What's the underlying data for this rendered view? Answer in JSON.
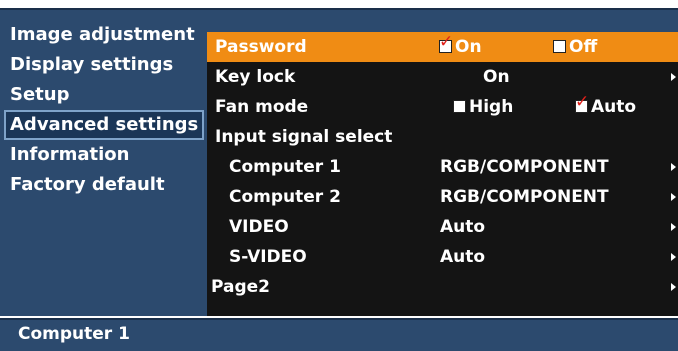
{
  "sidebar": {
    "items": [
      {
        "label": "Image adjustment"
      },
      {
        "label": "Display settings"
      },
      {
        "label": "Setup"
      },
      {
        "label": "Advanced settings",
        "selected": true
      },
      {
        "label": "Information"
      },
      {
        "label": "Factory default"
      }
    ]
  },
  "panel": {
    "password": {
      "label": "Password",
      "on_label": "On",
      "off_label": "Off",
      "selected": "On"
    },
    "keylock": {
      "label": "Key lock",
      "value": "On"
    },
    "fanmode": {
      "label": "Fan mode",
      "high_label": "High",
      "auto_label": "Auto",
      "selected": "Auto"
    },
    "input_signal": {
      "label": "Input signal select"
    },
    "computer1": {
      "label": "Computer 1",
      "value": "RGB/COMPONENT"
    },
    "computer2": {
      "label": "Computer 2",
      "value": "RGB/COMPONENT"
    },
    "video": {
      "label": "VIDEO",
      "value": "Auto"
    },
    "svideo": {
      "label": "S-VIDEO",
      "value": "Auto"
    },
    "page2": {
      "label": "Page2"
    }
  },
  "status": {
    "text": "Computer 1"
  },
  "colors": {
    "frame": "#2c4a6e",
    "panel": "#141414",
    "highlight": "#f08c14",
    "check": "#e0201a"
  }
}
